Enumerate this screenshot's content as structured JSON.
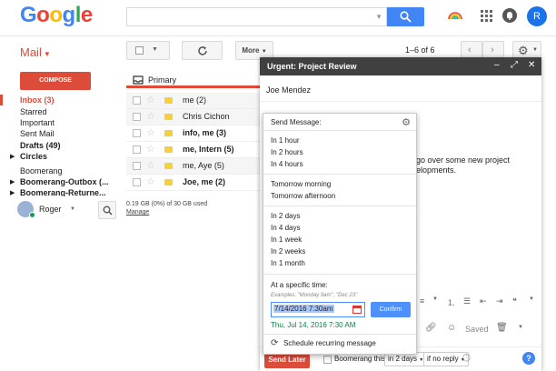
{
  "header": {
    "logo": [
      "G",
      "o",
      "o",
      "g",
      "l",
      "e"
    ],
    "logo_colors": [
      "#4285f4",
      "#ea4335",
      "#fbbc05",
      "#4285f4",
      "#34a853",
      "#ea4335"
    ],
    "search": {
      "placeholder": "",
      "value": ""
    },
    "avatar_initial": "R",
    "accent": "#4285f4"
  },
  "toolbar": {
    "mail_label": "Mail",
    "more_label": "More",
    "page_count": "1–6 of 6"
  },
  "sidebar": {
    "compose_label": "COMPOSE",
    "items": [
      {
        "label": "Inbox (3)"
      },
      {
        "label": "Starred"
      },
      {
        "label": "Important"
      },
      {
        "label": "Sent Mail"
      },
      {
        "label": "Drafts (49)"
      },
      {
        "label": "Circles"
      },
      {
        "label": "Boomerang"
      },
      {
        "label": "Boomerang-Outbox (..."
      },
      {
        "label": "Boomerang-Returne..."
      }
    ],
    "user_name": "Roger"
  },
  "inbox": {
    "tab_label": "Primary",
    "rows": [
      {
        "sender": "me (2)",
        "unread": false
      },
      {
        "sender": "Chris Cichon",
        "unread": false
      },
      {
        "sender": "info, me (3)",
        "unread": true
      },
      {
        "sender": "me, Intern (5)",
        "unread": true
      },
      {
        "sender": "me, Aye (5)",
        "unread": false
      },
      {
        "sender": "Joe, me (2)",
        "unread": true
      }
    ],
    "storage": "0.19 GB (0%) of 30 GB used",
    "manage": "Manage"
  },
  "compose": {
    "title": "Urgent: Project Review",
    "to": "Joe Mendez",
    "body_line1": "go over some new project",
    "body_line2": "elopments.",
    "saved_label": "Saved",
    "send_label": "Send Later",
    "boomerang_label": "Boomerang this",
    "boomerang_when": "in 2 days",
    "reply_condition": "if no reply"
  },
  "send_later": {
    "title": "Send Message:",
    "groups": [
      [
        "In 1 hour",
        "In 2 hours",
        "In 4 hours"
      ],
      [
        "Tomorrow morning",
        "Tomorrow afternoon"
      ],
      [
        "In 2 days",
        "In 4 days",
        "In 1 week",
        "In 2 weeks",
        "In 1 month"
      ]
    ],
    "specific_label": "At a specific time:",
    "examples": "Examples: \"Monday 9am\", \"Dec 23\"",
    "datetime_value": "7/14/2016 7:30am",
    "confirm_label": "Confirm",
    "parsed_value": "Thu, Jul 14, 2016 7:30 AM",
    "recurring_label": "Schedule recurring message"
  }
}
